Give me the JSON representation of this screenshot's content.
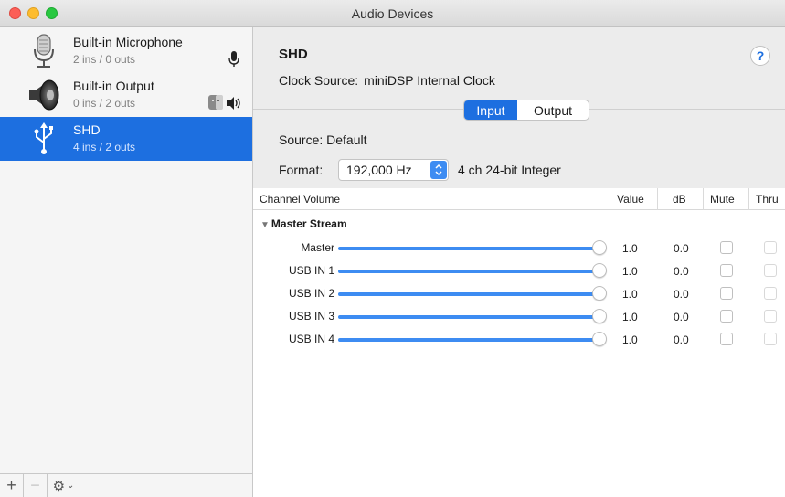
{
  "window": {
    "title": "Audio Devices"
  },
  "devices": [
    {
      "name": "Built-in Microphone",
      "io": "2 ins / 0 outs",
      "icon": "microphone-icon",
      "badges": [
        "mic-badge-icon"
      ]
    },
    {
      "name": "Built-in Output",
      "io": "0 ins / 2 outs",
      "icon": "speaker-icon",
      "badges": [
        "finder-badge-icon",
        "speaker-badge-icon"
      ]
    },
    {
      "name": "SHD",
      "io": "4 ins / 2 outs",
      "icon": "usb-icon",
      "selected": true
    }
  ],
  "sidebar_footer": {
    "add": "+",
    "remove": "−",
    "gear": "⚙",
    "gear_chevron": "⌄"
  },
  "detail": {
    "title": "SHD",
    "help": "?",
    "clock_label": "Clock Source:",
    "clock_value": "miniDSP Internal Clock",
    "tabs": [
      "Input",
      "Output"
    ],
    "active_tab": "Input",
    "source_label": "Source:",
    "source_value": "Default",
    "format_label": "Format:",
    "format_value": "192,000 Hz",
    "format_desc": "4 ch 24-bit Integer"
  },
  "table": {
    "headers": {
      "channel": "Channel Volume",
      "value": "Value",
      "db": "dB",
      "mute": "Mute",
      "thru": "Thru"
    },
    "group": "Master Stream",
    "rows": [
      {
        "label": "Master",
        "value": "1.0",
        "db": "0.0",
        "level": 1.0
      },
      {
        "label": "USB IN 1",
        "value": "1.0",
        "db": "0.0",
        "level": 1.0
      },
      {
        "label": "USB IN 2",
        "value": "1.0",
        "db": "0.0",
        "level": 1.0
      },
      {
        "label": "USB IN 3",
        "value": "1.0",
        "db": "0.0",
        "level": 1.0
      },
      {
        "label": "USB IN 4",
        "value": "1.0",
        "db": "0.0",
        "level": 1.0
      }
    ]
  },
  "colors": {
    "accent": "#1d6fe0",
    "slider": "#3d8cf2"
  }
}
